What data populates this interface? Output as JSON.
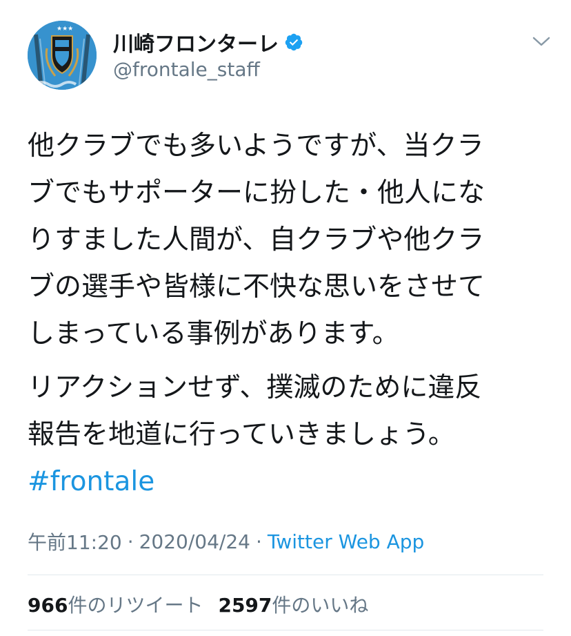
{
  "account": {
    "display_name": "川崎フロンターレ",
    "handle": "@frontale_staff",
    "verified": true,
    "avatar_icon": "club-emblem-avatar"
  },
  "menu": {
    "icon": "chevron-down-icon"
  },
  "tweet": {
    "lines_para1": [
      "他クラブでも多いようですが、当クラ",
      "ブでもサポーターに扮した・他人にな",
      "りすました人間が、自クラブや他クラ",
      "ブの選手や皆様に不快な思いをさせて",
      "しまっている事例があります。"
    ],
    "lines_para2": [
      "リアクションせず、撲滅のために違反",
      "報告を地道に行っていきましょう。"
    ],
    "hashtag": "#frontale"
  },
  "meta": {
    "time": "午前11:20",
    "separator": "·",
    "date": "2020/04/24",
    "source": "Twitter Web App"
  },
  "stats": {
    "retweets_count": "966",
    "retweets_label": "件のリツイート",
    "likes_count": "2597",
    "likes_label": "件のいいね"
  },
  "colors": {
    "link": "#1b95e0",
    "secondary_text": "#657786",
    "primary_text": "#14171a",
    "divider": "#e1e8ed",
    "avatar_bg": "#3d9ad6"
  }
}
